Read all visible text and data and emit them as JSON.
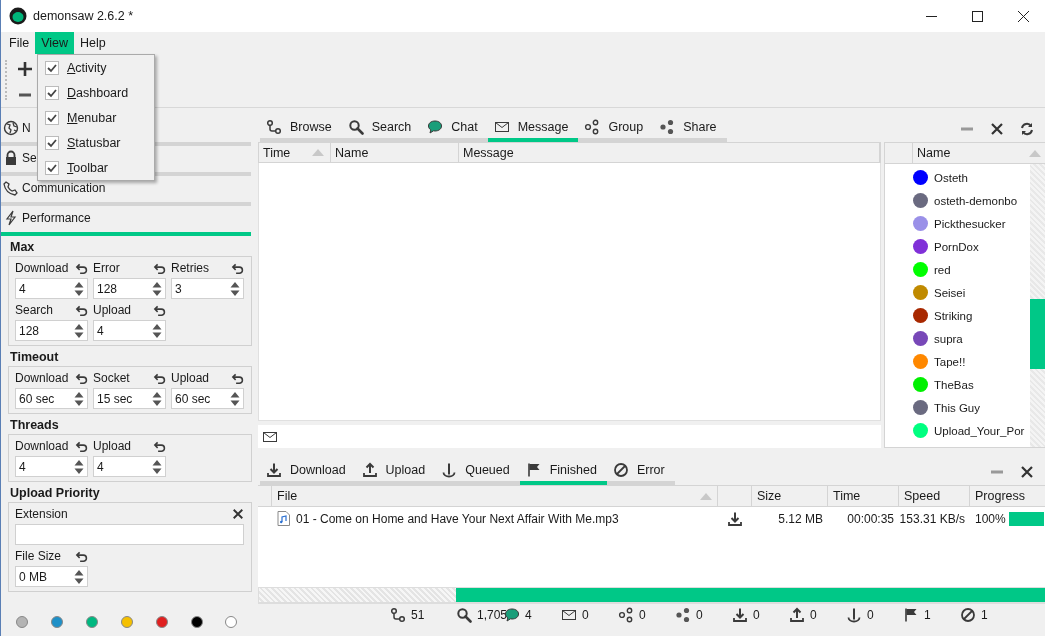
{
  "window": {
    "title": "demonsaw 2.6.2 *"
  },
  "menubar": [
    {
      "label": "File",
      "selected": false
    },
    {
      "label": "View",
      "selected": true
    },
    {
      "label": "Help",
      "selected": false
    }
  ],
  "view_menu": [
    {
      "label": "Activity",
      "checked": true
    },
    {
      "label": "Dashboard",
      "checked": true
    },
    {
      "label": "Menubar",
      "checked": true
    },
    {
      "label": "Statusbar",
      "checked": true
    },
    {
      "label": "Toolbar",
      "checked": true
    }
  ],
  "sidebar": {
    "sections": [
      {
        "kind": "network",
        "label": "N",
        "selected": false
      },
      {
        "kind": "security",
        "label": "Se",
        "selected": false
      },
      {
        "kind": "communication",
        "label": "Communication",
        "selected": false
      },
      {
        "kind": "performance",
        "label": "Performance",
        "selected": true
      }
    ],
    "groups": [
      {
        "title": "Max",
        "fields": [
          {
            "kind": "spin",
            "label": "Download",
            "value": "4"
          },
          {
            "kind": "spin",
            "label": "Error",
            "value": "128"
          },
          {
            "kind": "spin",
            "label": "Retries",
            "value": "3"
          },
          {
            "kind": "spin",
            "label": "Search",
            "value": "128"
          },
          {
            "kind": "spin",
            "label": "Upload",
            "value": "4"
          }
        ]
      },
      {
        "title": "Timeout",
        "fields": [
          {
            "kind": "spin",
            "label": "Download",
            "value": "60 sec"
          },
          {
            "kind": "spin",
            "label": "Socket",
            "value": "15 sec"
          },
          {
            "kind": "spin",
            "label": "Upload",
            "value": "60 sec"
          }
        ]
      },
      {
        "title": "Threads",
        "fields": [
          {
            "kind": "spin",
            "label": "Download",
            "value": "4"
          },
          {
            "kind": "spin",
            "label": "Upload",
            "value": "4"
          }
        ]
      },
      {
        "title": "Upload Priority",
        "fields": [
          {
            "kind": "text",
            "label": "Extension"
          },
          {
            "kind": "spin",
            "label": "File Size",
            "value": "0 MB"
          }
        ]
      }
    ],
    "color_dots": [
      {
        "color": "#b4b4b4"
      },
      {
        "color": "#1e90c8"
      },
      {
        "color": "#00b880"
      },
      {
        "color": "#f5c000"
      },
      {
        "color": "#e02020"
      },
      {
        "color": "#000000"
      },
      {
        "color": "#ffffff"
      }
    ]
  },
  "tabs": [
    {
      "kind": "browse",
      "label": "Browse",
      "selected": false
    },
    {
      "kind": "search",
      "label": "Search",
      "selected": false
    },
    {
      "kind": "chat",
      "label": "Chat",
      "selected": false
    },
    {
      "kind": "message",
      "label": "Message",
      "selected": true
    },
    {
      "kind": "group",
      "label": "Group",
      "selected": false
    },
    {
      "kind": "share",
      "label": "Share",
      "selected": false
    }
  ],
  "message_table": {
    "columns": [
      "Time",
      "Name",
      "Message"
    ]
  },
  "users": {
    "columns": [
      "Name"
    ],
    "rows": [
      {
        "name": "Osteth",
        "color": "#0000ff"
      },
      {
        "name": "osteth-demonbo",
        "color": "#6a6a80"
      },
      {
        "name": "Pickthesucker",
        "color": "#9a90e8"
      },
      {
        "name": "PornDox",
        "color": "#8030d8"
      },
      {
        "name": "red",
        "color": "#00ff00"
      },
      {
        "name": "Seisei",
        "color": "#c08a00"
      },
      {
        "name": "Striking",
        "color": "#a82800"
      },
      {
        "name": "supra",
        "color": "#7848b8"
      },
      {
        "name": "Tape!!",
        "color": "#ff8800"
      },
      {
        "name": "TheBas",
        "color": "#00f000"
      },
      {
        "name": "This Guy",
        "color": "#6a6a80"
      },
      {
        "name": "Upload_Your_Por",
        "color": "#00ff80"
      }
    ]
  },
  "transfer_tabs": [
    {
      "kind": "download",
      "label": "Download",
      "selected": false
    },
    {
      "kind": "upload",
      "label": "Upload",
      "selected": false
    },
    {
      "kind": "queued",
      "label": "Queued",
      "selected": false
    },
    {
      "kind": "finished",
      "label": "Finished",
      "selected": true
    },
    {
      "kind": "error",
      "label": "Error",
      "selected": false
    }
  ],
  "transfers": {
    "columns": [
      "File",
      "Size",
      "Time",
      "Speed",
      "Progress"
    ],
    "rows": [
      {
        "file": "01 - Come on Home and Have Your Next Affair With Me.mp3",
        "size": "5.12 MB",
        "time": "00:00:35",
        "speed": "153.31 KB/s",
        "progress": "100%",
        "level": 1
      }
    ]
  },
  "overall_progress": {
    "level": 0.75
  },
  "status_bar": [
    {
      "kind": "browse",
      "value": "51"
    },
    {
      "kind": "search",
      "value": "1,705"
    },
    {
      "kind": "chat",
      "value": "4"
    },
    {
      "kind": "message",
      "value": "0"
    },
    {
      "kind": "group",
      "value": "0"
    },
    {
      "kind": "share",
      "value": "0"
    },
    {
      "kind": "download",
      "value": "0"
    },
    {
      "kind": "upload",
      "value": "0"
    },
    {
      "kind": "queued",
      "value": "0"
    },
    {
      "kind": "finished",
      "value": "1"
    },
    {
      "kind": "error",
      "value": "1"
    }
  ]
}
